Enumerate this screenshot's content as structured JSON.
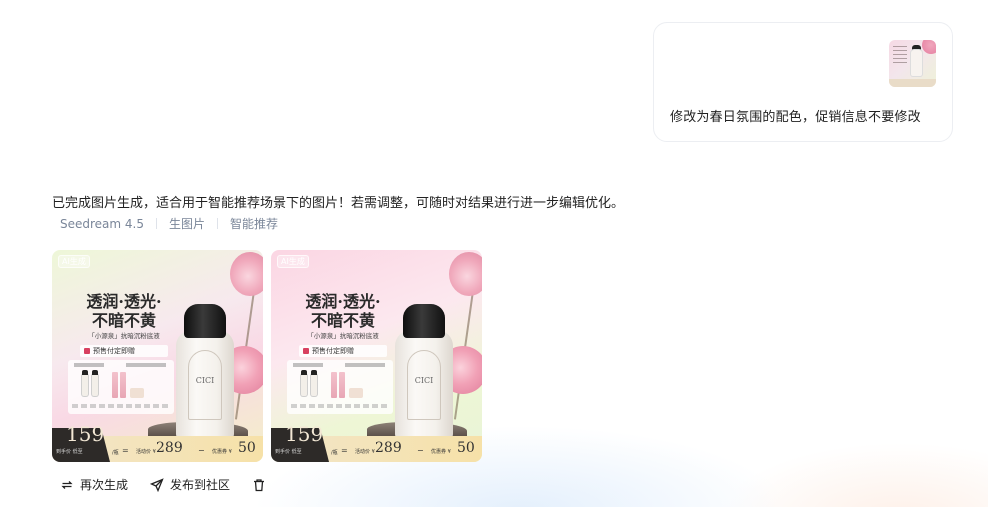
{
  "user_message": {
    "text": "修改为春日氛围的配色，促销信息不要修改",
    "attachment_icon": "image-thumbnail"
  },
  "response": {
    "text": "已完成图片生成，适合用于智能推荐场景下的图片！若需调整，可随时对结果进行进一步编辑优化。",
    "meta": [
      "Seedream 4.5",
      "生图片",
      "智能推荐"
    ]
  },
  "posters": [
    {
      "tag": "AI生成",
      "headline_1": "透润·透光·",
      "headline_2": "不暗不黄",
      "subline": "「小源泉」抗暗沉粉底液",
      "presale": "预售付定即赠",
      "price_main": "159",
      "price_unit": "/瓶",
      "price_small": "到手价 低至",
      "eq": "=",
      "act_label": "活动价 ¥",
      "act_value": "289",
      "minus": "−",
      "coupon_label": "优惠券 ¥",
      "coupon_value": "50",
      "bottle_logo": "CICI",
      "palette": "spring-green-pink"
    },
    {
      "tag": "AI生成",
      "headline_1": "透润·透光·",
      "headline_2": "不暗不黄",
      "subline": "「小源泉」抗暗沉粉底液",
      "presale": "预售付定即赠",
      "price_main": "159",
      "price_unit": "/瓶",
      "price_small": "到手价 低至",
      "eq": "=",
      "act_label": "活动价 ¥",
      "act_value": "289",
      "minus": "−",
      "coupon_label": "优惠券 ¥",
      "coupon_value": "50",
      "bottle_logo": "CICI",
      "palette": "spring-pink-green"
    }
  ],
  "actions": {
    "regenerate": "再次生成",
    "publish": "发布到社区",
    "delete_icon": "trash-icon"
  },
  "colors": {
    "meta_text": "#7a8699",
    "bubble_border": "#eceef2"
  }
}
